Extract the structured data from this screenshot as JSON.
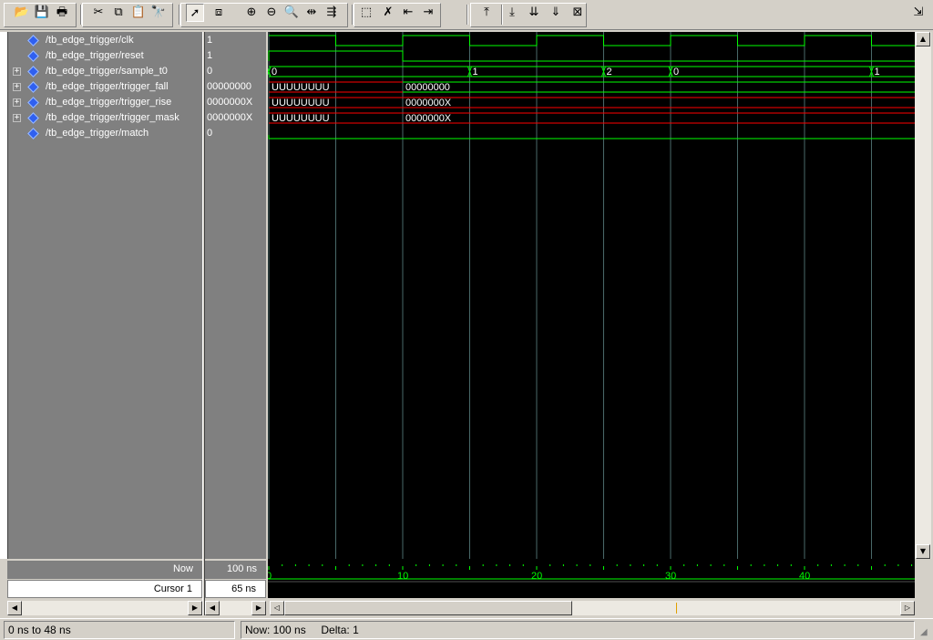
{
  "toolbar": {
    "buttons": [
      {
        "name": "open-icon",
        "glyph": "📂"
      },
      {
        "name": "save-icon",
        "glyph": "💾"
      },
      {
        "name": "print-icon",
        "glyph": "🖶"
      },
      {
        "name": "cut-icon",
        "glyph": "✂"
      },
      {
        "name": "copy-icon",
        "glyph": "⧉"
      },
      {
        "name": "paste-icon",
        "glyph": "📋"
      },
      {
        "name": "find-icon",
        "glyph": "🔭"
      },
      {
        "name": "select-mode-icon",
        "glyph": "➚"
      },
      {
        "name": "zoom-mode-icon",
        "glyph": "⧈"
      },
      {
        "name": "zoom-in-icon",
        "glyph": "⊕"
      },
      {
        "name": "zoom-out-icon",
        "glyph": "⊖"
      },
      {
        "name": "zoom-full-icon",
        "glyph": "🔍"
      },
      {
        "name": "zoom-cursor-icon",
        "glyph": "⇹"
      },
      {
        "name": "zoom-range-icon",
        "glyph": "⇶"
      },
      {
        "name": "add-cursor-icon",
        "glyph": "⬚"
      },
      {
        "name": "delete-cursor-icon",
        "glyph": "✗"
      },
      {
        "name": "prev-edge-icon",
        "glyph": "⇤"
      },
      {
        "name": "next-edge-icon",
        "glyph": "⇥"
      },
      {
        "name": "find-first-edge-icon",
        "glyph": "⤒"
      },
      {
        "name": "find-prev-edge-icon",
        "glyph": "⤓"
      },
      {
        "name": "find-next-edge-icon",
        "glyph": "⇊"
      },
      {
        "name": "find-last-edge-icon",
        "glyph": "⇓"
      },
      {
        "name": "stop-find-icon",
        "glyph": "⊠"
      },
      {
        "name": "dock-icon",
        "glyph": "⇲"
      }
    ]
  },
  "signals": [
    {
      "name": "/tb_edge_trigger/clk",
      "value": "1",
      "expandable": false
    },
    {
      "name": "/tb_edge_trigger/reset",
      "value": "1",
      "expandable": false
    },
    {
      "name": "/tb_edge_trigger/sample_t0",
      "value": "0",
      "expandable": true
    },
    {
      "name": "/tb_edge_trigger/trigger_fall",
      "value": "00000000",
      "expandable": true
    },
    {
      "name": "/tb_edge_trigger/trigger_rise",
      "value": "0000000X",
      "expandable": true
    },
    {
      "name": "/tb_edge_trigger/trigger_mask",
      "value": "0000000X",
      "expandable": true
    },
    {
      "name": "/tb_edge_trigger/match",
      "value": "0",
      "expandable": false
    }
  ],
  "expander_glyph": "+",
  "waves": {
    "sample_t0_labels": [
      {
        "t": 0,
        "label": "0"
      },
      {
        "t": 15,
        "label": "1"
      },
      {
        "t": 25,
        "label": "2"
      },
      {
        "t": 30,
        "label": "0"
      },
      {
        "t": 45,
        "label": "1"
      }
    ],
    "bus_labels": {
      "trigger_fall": [
        {
          "t": 0,
          "label": "UUUUUUUU"
        },
        {
          "t": 10,
          "label": "00000000"
        }
      ],
      "trigger_rise": [
        {
          "t": 0,
          "label": "UUUUUUUU"
        },
        {
          "t": 10,
          "label": "0000000X"
        }
      ],
      "trigger_mask": [
        {
          "t": 0,
          "label": "UUUUUUUU"
        },
        {
          "t": 10,
          "label": "0000000X"
        }
      ]
    },
    "clk_period_ns": 10,
    "reset_low_from_ns": 10,
    "time_range_ns": [
      0,
      48
    ],
    "grid_every_ns": 5
  },
  "axis": {
    "ticks": [
      {
        "t": 0,
        "label": "0"
      },
      {
        "t": 10,
        "label": "10"
      },
      {
        "t": 20,
        "label": "20"
      },
      {
        "t": 30,
        "label": "30"
      },
      {
        "t": 40,
        "label": "40"
      }
    ]
  },
  "bottom": {
    "now_label": "Now",
    "now_value": "100 ns",
    "cursor_label": "Cursor 1",
    "cursor_value": "65 ns"
  },
  "status": {
    "range": "0 ns to 48 ns",
    "now": "Now: 100 ns",
    "delta": "Delta: 1"
  },
  "colors": {
    "wave_green": "#00ff00",
    "wave_red": "#ff0000",
    "grid": "#4a6a6a",
    "axis_text": "#00ff00",
    "wave_text": "#ffffff"
  }
}
